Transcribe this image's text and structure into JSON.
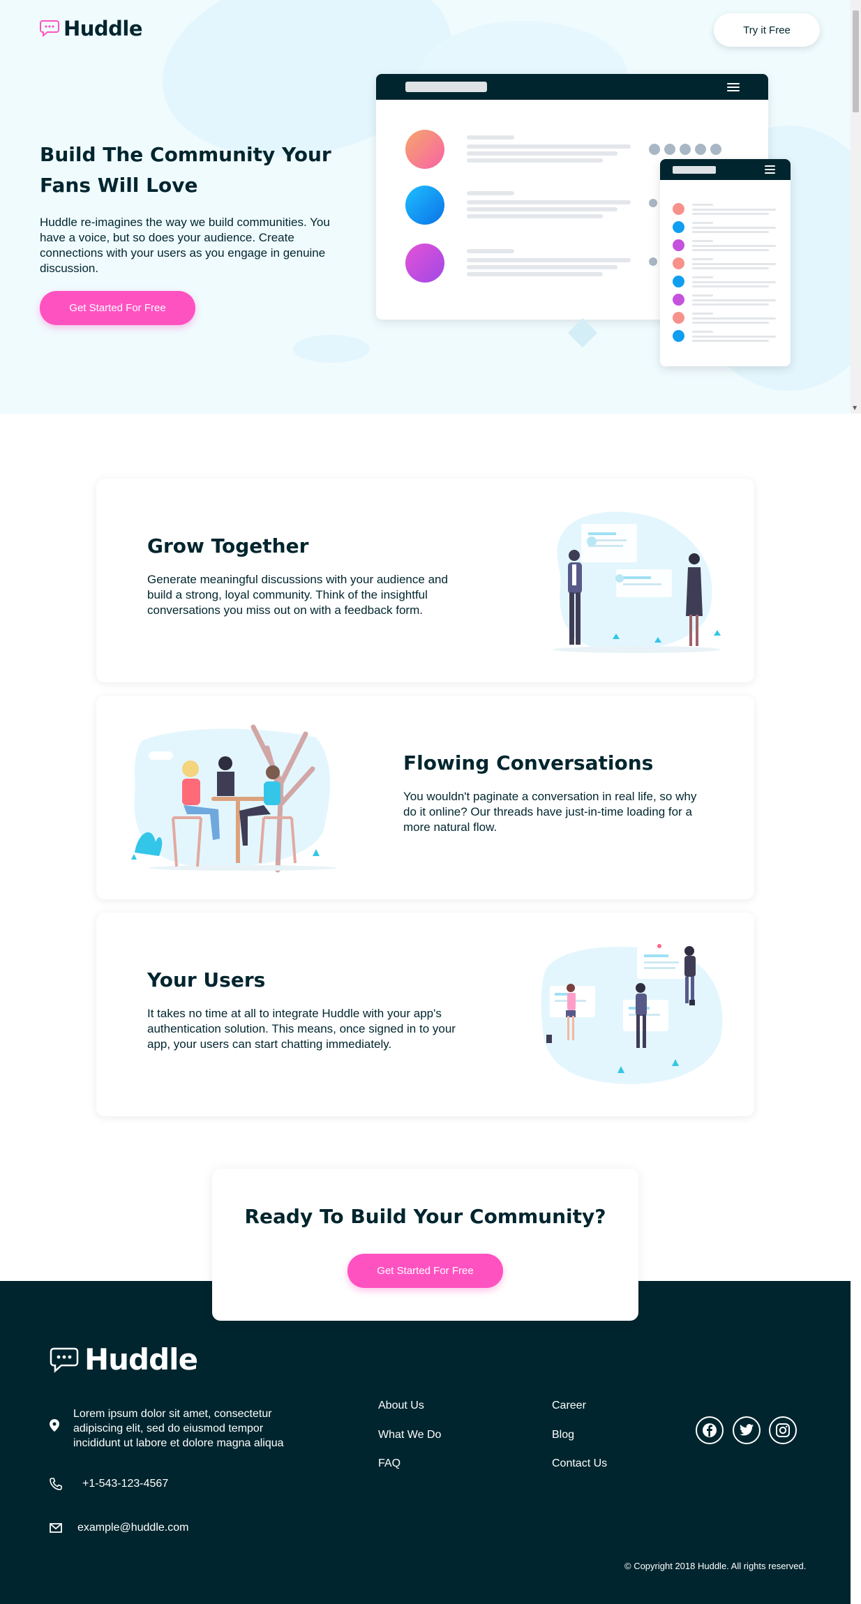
{
  "header": {
    "logo_text": "Huddle",
    "try_button": "Try it Free"
  },
  "hero": {
    "title": "Build The Community Your Fans Will Love",
    "description": "Huddle re-imagines the way we build communities. You have a voice, but so does your audience. Create connections with your users as you engage in genuine discussion.",
    "cta": "Get Started For Free"
  },
  "features": [
    {
      "title": "Grow Together",
      "text": "Generate meaningful discussions with your audience and build a strong, loyal community. Think of the insightful conversations you miss out on with a feedback form.",
      "illustration": "illustration-grow-together"
    },
    {
      "title": "Flowing Conversations",
      "text": "You wouldn't paginate a conversation in real life, so why do it online? Our threads have just-in-time loading for a more natural flow.",
      "illustration": "illustration-flowing-conversation"
    },
    {
      "title": "Your Users",
      "text": "It takes no time at all to integrate Huddle with your app's authentication solution. This means, once signed in to your app, your users can start chatting immediately.",
      "illustration": "illustration-your-users"
    }
  ],
  "cta": {
    "title": "Ready To Build Your Community?",
    "button": "Get Started For Free"
  },
  "footer": {
    "logo_text": "Huddle",
    "address": "Lorem ipsum dolor sit amet, consectetur adipiscing elit, sed do eiusmod tempor incididunt ut labore et dolore magna aliqua",
    "phone": "+1-543-123-4567",
    "email": "example@huddle.com",
    "links_col1": [
      "About Us",
      "What We Do",
      "FAQ"
    ],
    "links_col2": [
      "Career",
      "Blog",
      "Contact Us"
    ],
    "social": [
      "facebook-icon",
      "twitter-icon",
      "instagram-icon"
    ],
    "copyright": "© Copyright 2018 Huddle. All rights reserved."
  },
  "colors": {
    "dark": "#00252e",
    "pink": "#ff52c1",
    "hero_bg": "#f0fbfe"
  }
}
